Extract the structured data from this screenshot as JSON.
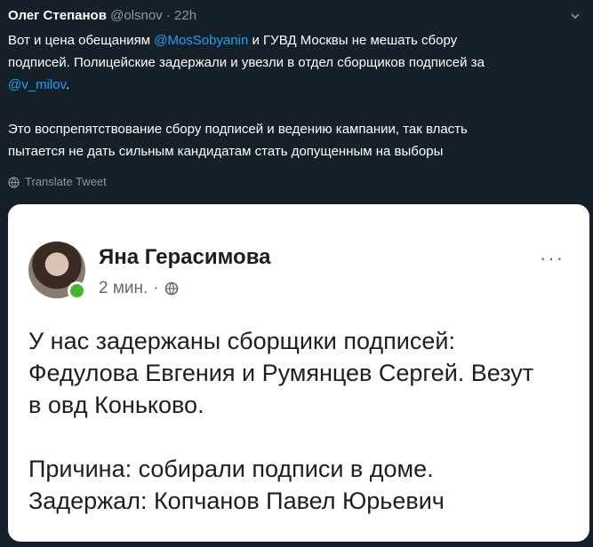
{
  "tweet": {
    "author_name": "Олег Степанов",
    "handle": "@olsnov",
    "separator": "·",
    "time": "22h",
    "line1_prefix": "Вот и цена обещаниям ",
    "mention1": "@MosSobyanin",
    "line1_suffix": " и ГУВД Москвы не мешать сбору",
    "line2": "подписей. Полицейские задержали и увезли в отдел сборщиков подписей за",
    "mention2": "@v_milov",
    "line2_end": ".",
    "line3": "Это воспрепятствование сбору подписей и ведению кампании, так власть",
    "line4": "пытается не дать сильным кандидатам стать допущенным на выборы",
    "translate_label": "Translate Tweet"
  },
  "fb_post": {
    "author_name": "Яна Герасимова",
    "time": "2 мин.",
    "dot": "·",
    "more": "···",
    "line1": "У нас задержаны сборщики подписей:",
    "line2": "Федулова Евгения и Румянцев Сергей. Везут",
    "line3": "в овд Коньково.",
    "line4": "Причина: собирали подписи в доме.",
    "line5": "Задержал: Копчанов Павел Юрьевич"
  },
  "colors": {
    "background": "#15202b",
    "link": "#1da1f2",
    "muted": "#8899a6",
    "online": "#42b72a"
  },
  "icons": [
    "chevron-down-icon",
    "globe-icon",
    "more-options-icon"
  ]
}
